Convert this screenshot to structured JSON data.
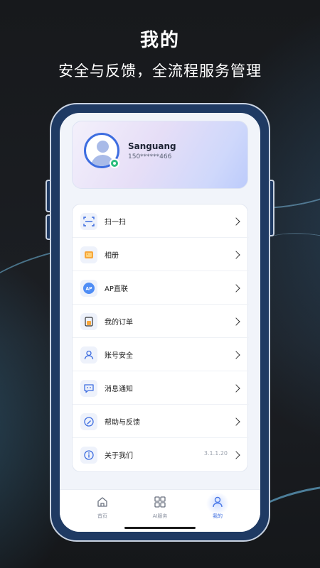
{
  "promo": {
    "title": "我的",
    "subtitle": "安全与反馈，全流程服务管理"
  },
  "profile": {
    "name": "Sanguang",
    "phone": "150******466",
    "status_color": "#2bbd7e"
  },
  "menu": {
    "items": [
      {
        "label": "扫一扫",
        "icon": "scan-icon"
      },
      {
        "label": "相册",
        "icon": "album-icon"
      },
      {
        "label": "AP直联",
        "icon": "ap-direct-icon"
      },
      {
        "label": "我的订单",
        "icon": "order-icon"
      },
      {
        "label": "账号安全",
        "icon": "account-security-icon"
      },
      {
        "label": "消息通知",
        "icon": "message-icon"
      },
      {
        "label": "帮助与反馈",
        "icon": "help-icon"
      },
      {
        "label": "关于我们",
        "icon": "info-icon"
      }
    ],
    "version": "3.1.1.20",
    "ap_badge": "AP"
  },
  "tabbar": {
    "tabs": [
      {
        "label": "首页",
        "icon": "home-icon"
      },
      {
        "label": "AI服务",
        "icon": "grid-icon"
      },
      {
        "label": "我的",
        "icon": "user-icon"
      }
    ],
    "active": "我的",
    "accent": "#3d6de0"
  }
}
